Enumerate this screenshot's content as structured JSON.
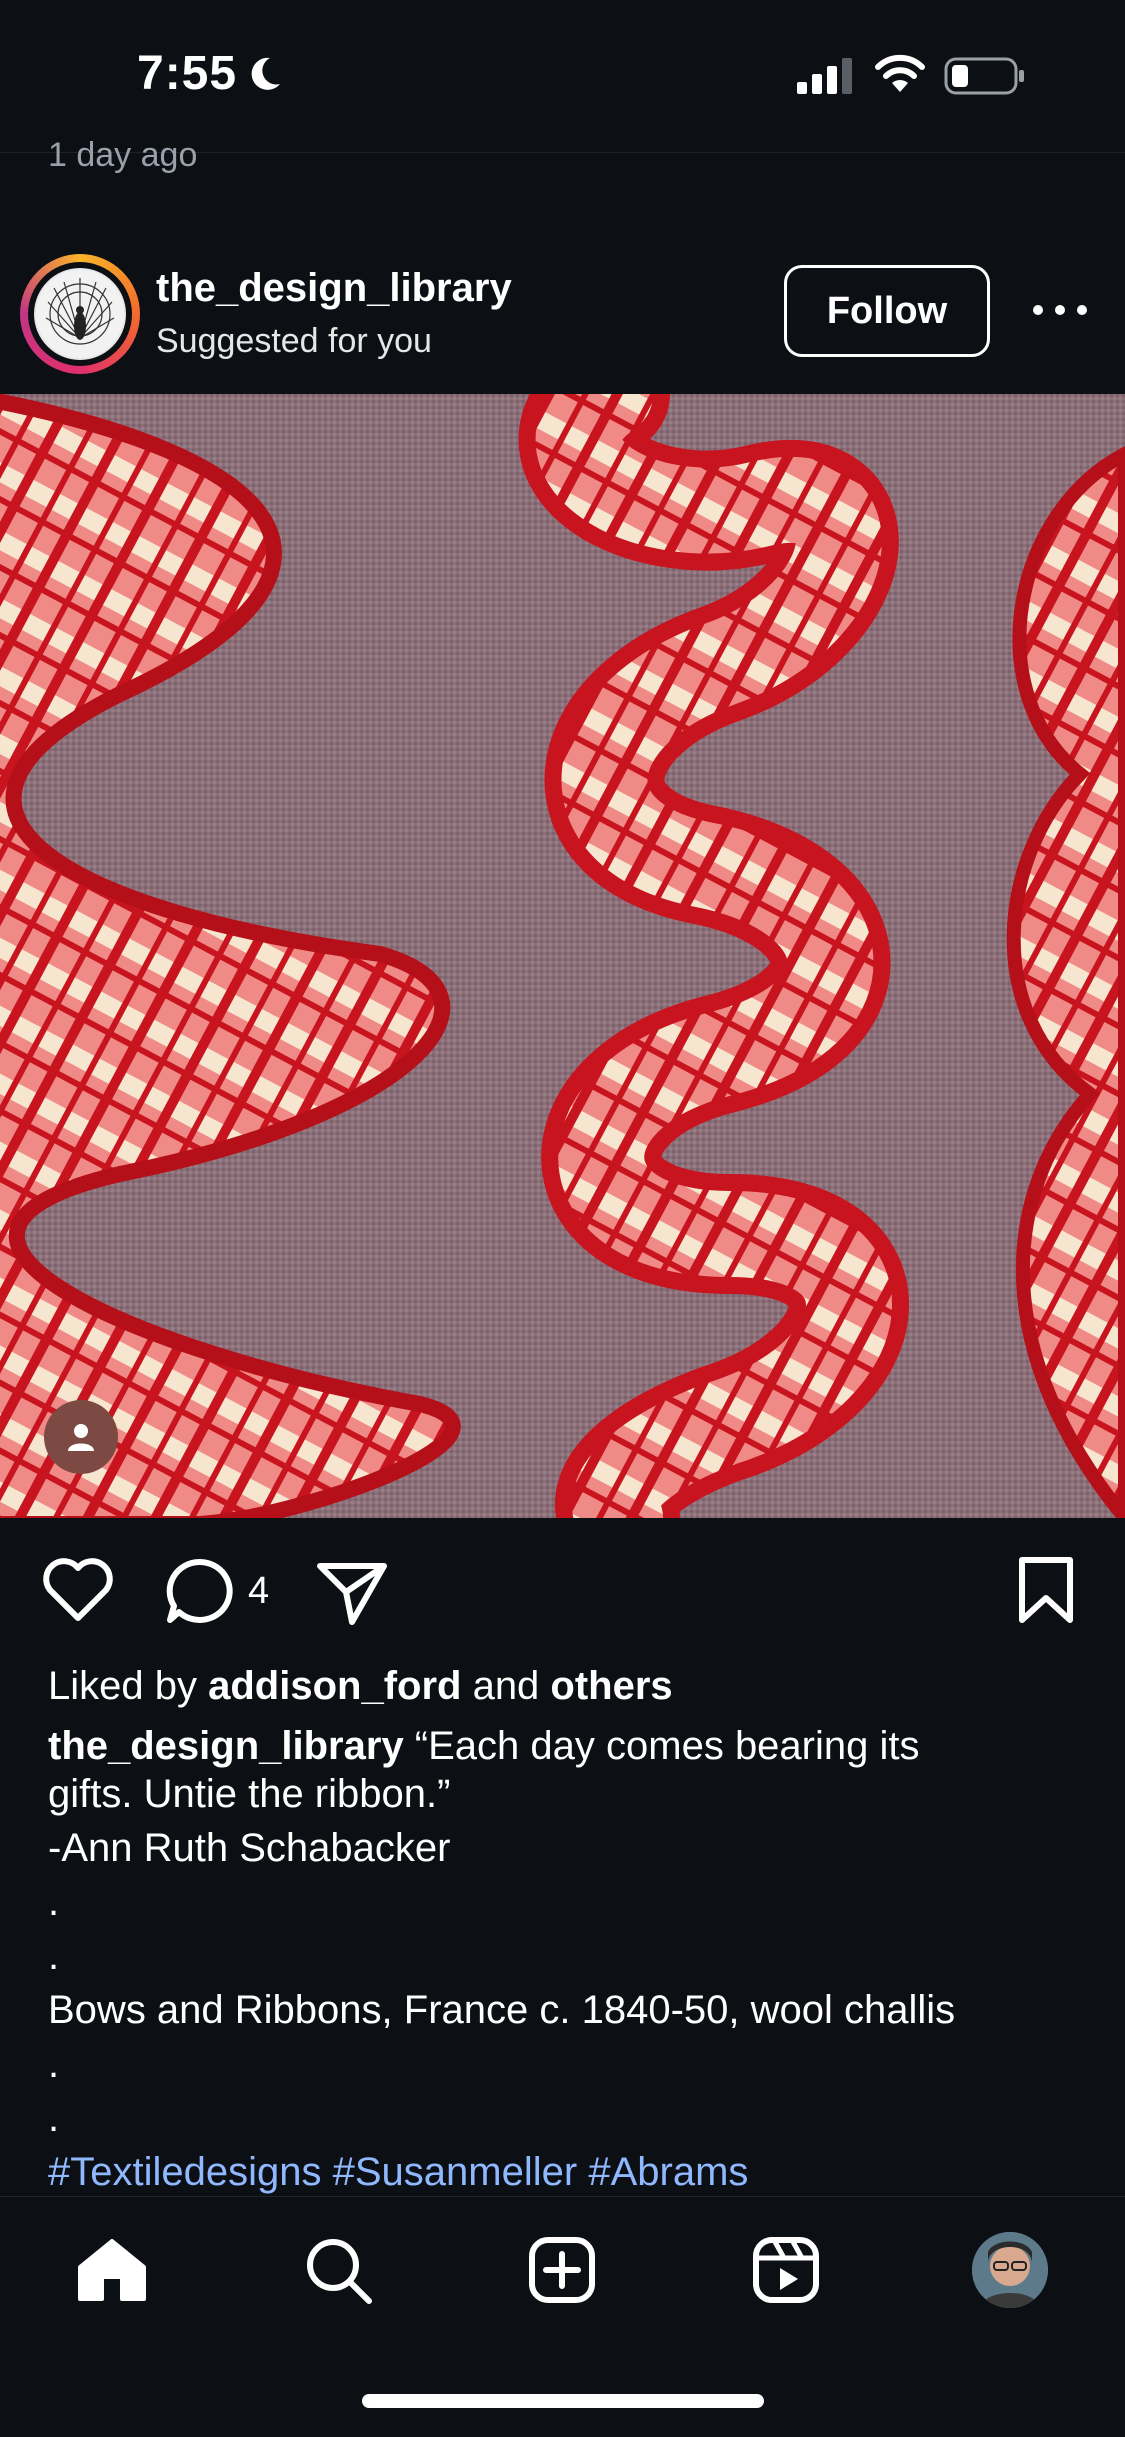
{
  "status_bar": {
    "time": "7:55",
    "icons": [
      "moon-icon",
      "signal-icon",
      "wifi-icon",
      "battery-icon"
    ]
  },
  "feed": {
    "previous_post_timestamp": "1 day ago"
  },
  "post": {
    "username": "the_design_library",
    "subtitle": "Suggested for you",
    "follow_label": "Follow",
    "comment_count": "4",
    "liked_by_prefix": "Liked by ",
    "liked_by_user": "addison_ford",
    "liked_by_and": " and ",
    "liked_by_others": "others",
    "caption_username": "the_design_library",
    "caption_line1": " “Each day comes bearing its",
    "caption_line2": "gifts. Untie the ribbon.”",
    "caption_line3": "-Ann Ruth Schabacker",
    "caption_dot": ".",
    "caption_line6": "Bows and Ribbons, France c. 1840-50, wool challis",
    "hashtags": [
      "#Textiledesigns",
      "#Susanmeller",
      "#Abrams"
    ]
  },
  "colors": {
    "background": "#0c0f14",
    "hashtag": "#8fb8ff",
    "ribbon_red": "#d9252e",
    "fabric_bg": "#8a6f78"
  },
  "tab_bar": {
    "items": [
      "home-icon",
      "search-icon",
      "create-icon",
      "reels-icon",
      "profile-avatar"
    ]
  }
}
